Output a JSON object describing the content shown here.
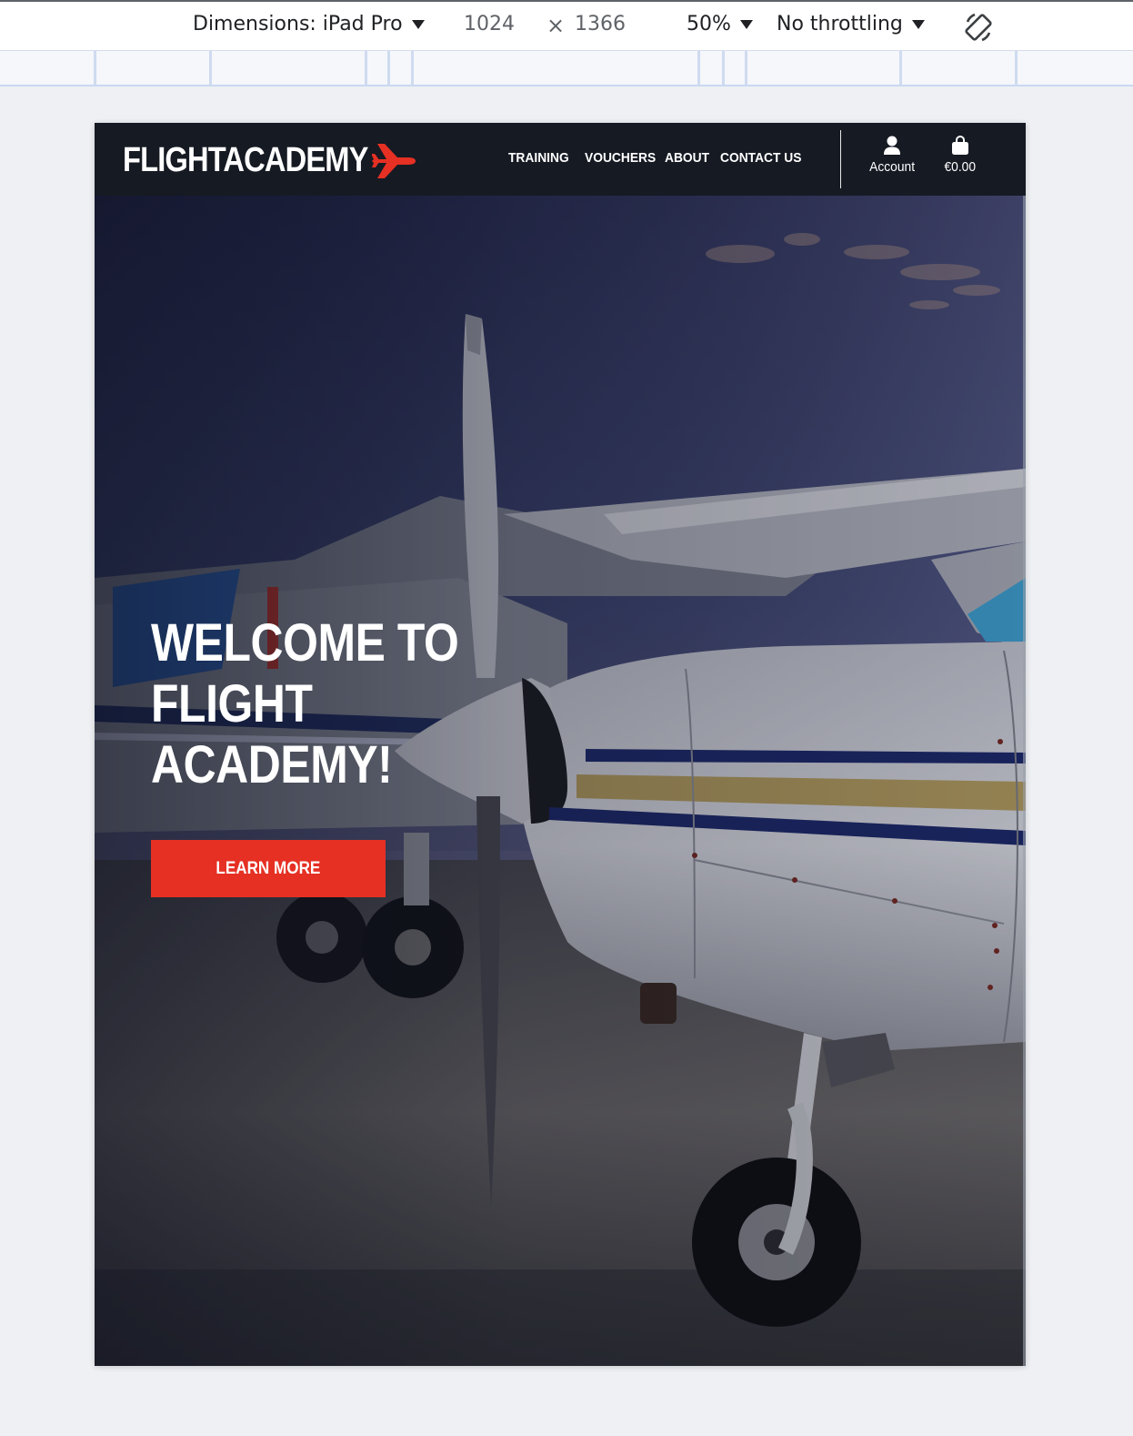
{
  "devtools": {
    "dimensions_label": "Dimensions: iPad Pro",
    "width": "1024",
    "times": "×",
    "height": "1366",
    "zoom": "50%",
    "throttling": "No throttling",
    "rotate_icon": "rotate-icon"
  },
  "site": {
    "logo_text": "FLIGHTACADEMY",
    "logo_icon": "airplane-icon",
    "accent_color": "#e53023",
    "header_bg": "#161a23",
    "nav": [
      "TRAINING",
      "VOUCHERS",
      "ABOUT",
      "CONTACT US"
    ],
    "account_label": "Account",
    "account_icon": "user-icon",
    "cart_label": "€0.00",
    "cart_icon": "shopping-bag-icon"
  },
  "hero": {
    "title": "WELCOME TO\nFLIGHT\nACADEMY!",
    "cta_label": "LEARN MORE"
  }
}
